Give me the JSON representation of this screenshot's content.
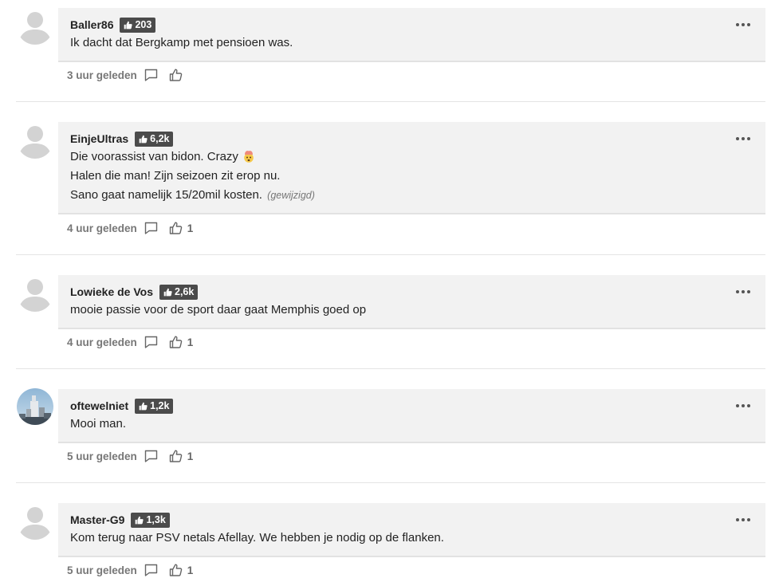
{
  "comments": [
    {
      "username": "Baller86",
      "karma": "203",
      "lines": [
        "Ik dacht dat Bergkamp met pensioen was."
      ],
      "edited": "",
      "time": "3 uur geleden",
      "likes": "",
      "avatar": "placeholder-avatar"
    },
    {
      "username": "EinjeUltras",
      "karma": "6,2k",
      "lines": [
        "Die voorassist van bidon. Crazy",
        "Halen die man! Zijn seizoen zit erop nu.",
        "Sano gaat namelijk 15/20mil kosten."
      ],
      "emoji": "exploding-head-emoji",
      "edited": "(gewijzigd)",
      "time": "4 uur geleden",
      "likes": "1",
      "avatar": "placeholder-avatar"
    },
    {
      "username": "Lowieke de Vos",
      "karma": "2,6k",
      "lines": [
        "mooie passie voor de sport daar gaat Memphis goed op"
      ],
      "edited": "",
      "time": "4 uur geleden",
      "likes": "1",
      "avatar": "placeholder-avatar"
    },
    {
      "username": "oftewelniet",
      "karma": "1,2k",
      "lines": [
        "Mooi man."
      ],
      "edited": "",
      "time": "5 uur geleden",
      "likes": "1",
      "avatar": "photo-avatar"
    },
    {
      "username": "Master-G9",
      "karma": "1,3k",
      "lines": [
        "Kom terug naar PSV netals Afellay. We hebben je nodig op de flanken."
      ],
      "edited": "",
      "time": "5 uur geleden",
      "likes": "1",
      "avatar": "placeholder-avatar"
    }
  ],
  "colors": {
    "bubble": "#f2f2f2",
    "badge": "#4b4b4b",
    "meta_text": "#777777"
  },
  "icons": {
    "more": "more-options-icon",
    "reply": "reply-icon",
    "like": "thumbs-up-icon"
  }
}
